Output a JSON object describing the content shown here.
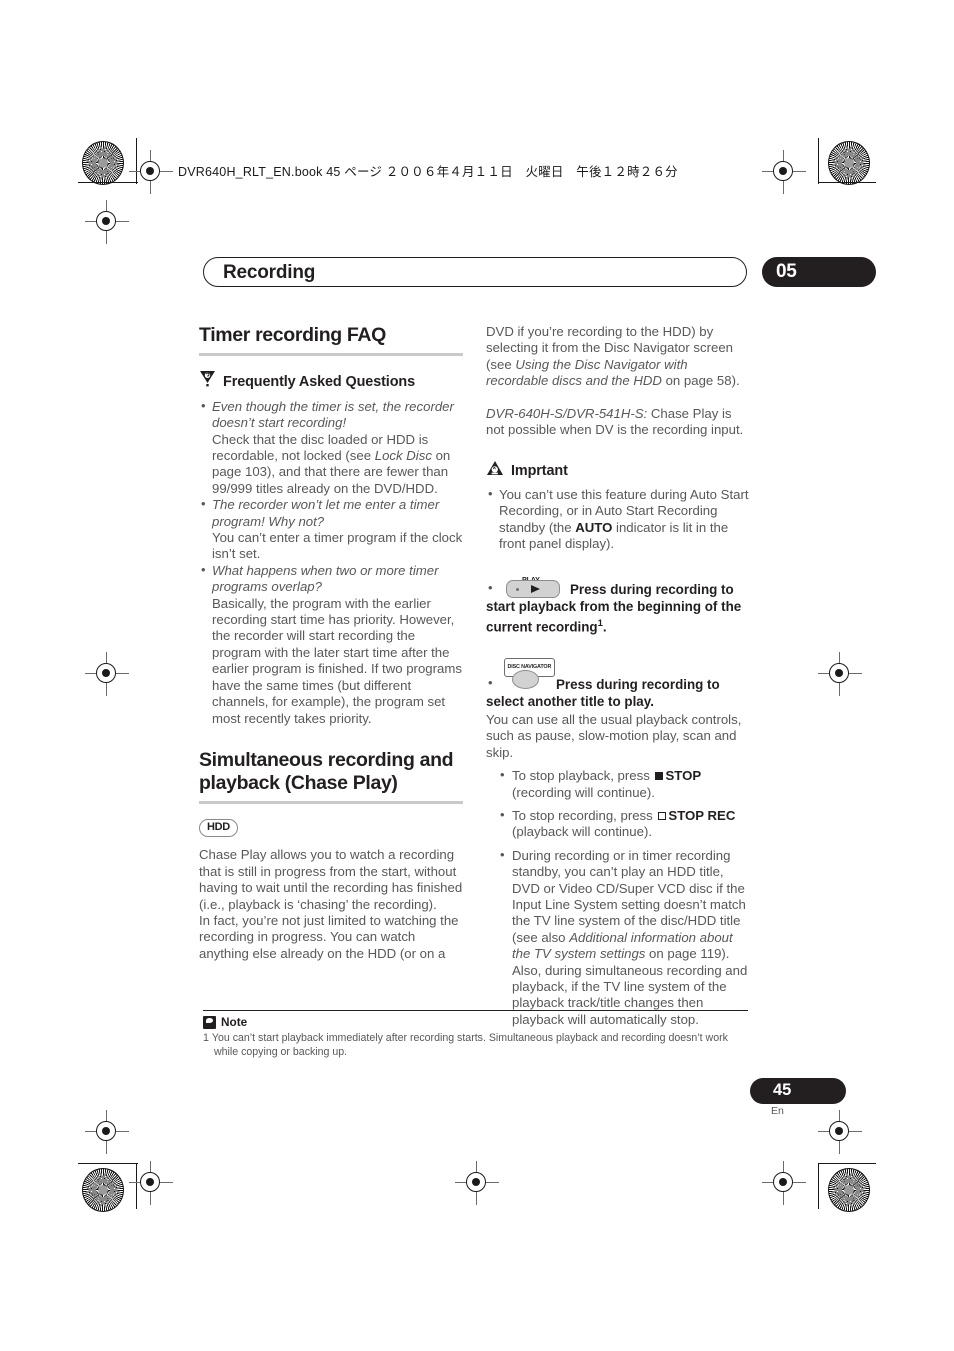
{
  "doc": {
    "header_line": "DVR640H_RLT_EN.book  45 ページ  ２００６年４月１１日　火曜日　午後１２時２６分",
    "chapter_title": "Recording",
    "chapter_number": "05",
    "page_number": "45",
    "page_language": "En"
  },
  "left": {
    "section1_title": "Timer recording FAQ",
    "faq": {
      "icon": "faq-question-triangle-icon",
      "label": "Frequently Asked Questions",
      "items": [
        {
          "question": "Even though the timer is set, the recorder doesn’t start recording!",
          "answer_pre": "Check that the disc loaded or HDD is recordable, not locked (see ",
          "answer_italic": "Lock Disc",
          "answer_post": " on page 103), and that there are fewer than 99/999 titles already on the DVD/HDD."
        },
        {
          "question": "The recorder won’t let me enter a timer program! Why not?",
          "answer_pre": "You can’t enter a timer program if the clock isn’t set.",
          "answer_italic": "",
          "answer_post": ""
        },
        {
          "question": "What happens when two or more timer programs overlap?",
          "answer_pre": "Basically, the program with the earlier recording start time has priority. However, the recorder will start recording the program with the later start time after the earlier program is finished. If two programs have the same times (but different channels, for example), the program set most recently takes priority.",
          "answer_italic": "",
          "answer_post": ""
        }
      ]
    },
    "section2_title": "Simultaneous recording and playback (Chase Play)",
    "media_badge": "HDD",
    "body_para1": "Chase Play allows you to watch a recording that is still in progress from the start, without having to wait until the recording has finished (i.e., playback is ‘chasing’ the recording).",
    "body_para2": "In fact, you’re not just limited to watching the recording in progress. You can watch anything else already on the HDD (or on a"
  },
  "right": {
    "cont_para_pre": "DVD if you’re recording to the HDD) by selecting it from the Disc Navigator screen (see ",
    "cont_para_italic": "Using the Disc Navigator with recordable discs and the HDD",
    "cont_para_post": " on page 58).",
    "model_note_italic": "DVR-640H-S/DVR-541H-S:",
    "model_note_post": " Chase Play is not possible when DV is the recording input.",
    "important": {
      "icon": "warning-triangle-hand-icon",
      "label": "Imprtant",
      "bullet_pre": "You can’t use this feature during Auto Start Recording, or in Auto Start Recording standby (the ",
      "bullet_bold": "AUTO",
      "bullet_post": " indicator is lit in the front panel display)."
    },
    "play_step": {
      "key_label": "PLAY",
      "text_pre": "Press during recording to start playback from the beginning of the current recording",
      "footnote_marker": "1",
      "text_post": "."
    },
    "disc_nav_step": {
      "key_label": "DISC NAVIGATOR",
      "text": "Press during recording to select another title to play."
    },
    "controls_para": "You can use all the usual playback controls, such as pause, slow-motion play, scan and skip.",
    "sub_bullets": [
      {
        "pre": "To stop playback, press ",
        "icon": "solid-square-icon",
        "bold": "STOP",
        "post": " (recording will continue)."
      },
      {
        "pre": "To stop recording, press ",
        "icon": "open-square-icon",
        "bold": "STOP REC",
        "post": " (playback will continue)."
      },
      {
        "pre": "During recording or in timer recording standby, you can’t play an HDD title, DVD or Video CD/Super VCD disc if the Input Line System setting doesn’t match the TV line system of the disc/HDD title (see also ",
        "icon": "",
        "bold": "",
        "italic": "Additional information about the TV system settings",
        "post": " on page 119). Also, during simultaneous recording and playback, if the TV line system of the playback track/title changes then playback will automatically stop."
      }
    ]
  },
  "note": {
    "icon": "note-balloon-icon",
    "label": "Note",
    "index": "1",
    "text": "You can’t start playback immediately after recording starts. Simultaneous playback and recording doesn’t work",
    "text_cont": "while copying or backing up."
  }
}
